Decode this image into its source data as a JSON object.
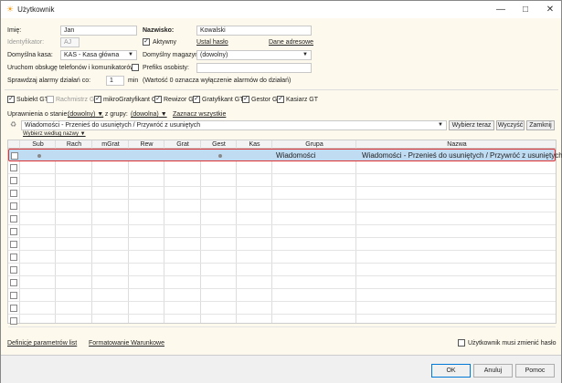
{
  "window": {
    "title": "Użytkownik",
    "icon": "app-sun-icon"
  },
  "form": {
    "imie_label": "Imię:",
    "imie_value": "Jan",
    "nazwisko_label": "Nazwisko:",
    "nazwisko_value": "Kowalski",
    "identyfikator_label": "Identyfikator:",
    "identyfikator_value": "AJ",
    "aktywny_label": "Aktywny",
    "aktywny_checked": true,
    "ustal_haslo": "Ustal hasło",
    "dane_adresowe": "Dane adresowe",
    "kasa_label": "Domyślna kasa:",
    "kasa_value": "KAS - Kasa główna",
    "magazyn_label": "Domyślny magazyn:",
    "magazyn_value": "(dowolny)",
    "telefony_label": "Uruchom obsługę telefonów i komunikatorów",
    "telefony_checked": false,
    "prefiks_label": "Prefiks osobisty:",
    "prefiks_value": "",
    "alarmy_label": "Sprawdzaj alarmy działań co:",
    "alarmy_value": "1",
    "alarmy_unit": "min",
    "alarmy_note": "(Wartość 0 oznacza wyłączenie alarmów do działań)"
  },
  "modules": [
    {
      "label": "Subiekt GT",
      "checked": true,
      "enabled": true
    },
    {
      "label": "Rachmistrz GT",
      "checked": false,
      "enabled": false
    },
    {
      "label": "mikroGratyfikant GT",
      "checked": true,
      "enabled": true
    },
    {
      "label": "Rewizor GT",
      "checked": true,
      "enabled": true
    },
    {
      "label": "Gratyfikant GT",
      "checked": true,
      "enabled": true
    },
    {
      "label": "Gestor GT",
      "checked": true,
      "enabled": true
    },
    {
      "label": "Kasiarz GT",
      "checked": true,
      "enabled": true
    }
  ],
  "filters": {
    "stan_label": "Uprawnienia o stanie:",
    "stan_value": "(dowolny)",
    "grupa_label": ", z grupy:",
    "grupa_value": "(dowolna)",
    "zaznacz": "Zaznacz wszystkie",
    "search_value": "Wiadomości - Przenieś do usuniętych / Przywróć z usuniętych",
    "wybierz_teraz": "Wybierz teraz",
    "wyczysc": "Wyczyść",
    "zamknij": "Zamknij",
    "wybierz_wg": "Wybierz według nazwy"
  },
  "grid": {
    "columns": [
      "Sub",
      "Rach",
      "mGrat",
      "Rew",
      "Grat",
      "Gest",
      "Kas",
      "Grupa",
      "Nazwa"
    ],
    "rows": [
      {
        "checked": false,
        "Sub": true,
        "Rach": false,
        "mGrat": false,
        "Rew": false,
        "Grat": false,
        "Gest": true,
        "Kas": false,
        "Grupa": "Wiadomości",
        "Nazwa": "Wiadomości - Przenieś do usuniętych / Przywróć z usuniętych",
        "selected": true
      }
    ]
  },
  "footer": {
    "definicje": "Definicje parametrów list",
    "formatowanie": "Formatowanie Warunkowe",
    "musi_zmienic": "Użytkownik musi zmienić hasło",
    "musi_zmienic_checked": false,
    "ok": "OK",
    "anuluj": "Anuluj",
    "pomoc": "Pomoc"
  },
  "colors": {
    "content_bg": "#fdf9ec",
    "selected_row": "#bfdcf3",
    "highlight_border": "#e03030"
  }
}
